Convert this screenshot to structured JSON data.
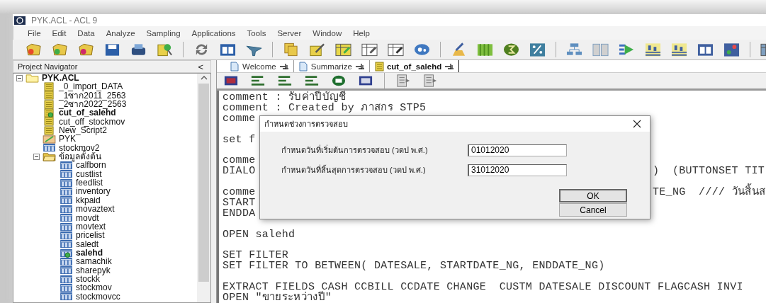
{
  "window": {
    "title": "PYK.ACL - ACL 9"
  },
  "menu": [
    "File",
    "Edit",
    "Data",
    "Analyze",
    "Sampling",
    "Applications",
    "Tools",
    "Server",
    "Window",
    "Help"
  ],
  "navigator": {
    "title": "Project Navigator",
    "collapse": "<",
    "tree": [
      {
        "label": "PYK.ACL",
        "kind": "project",
        "expanded": true,
        "active": false,
        "children": [
          {
            "label": "_0_import_DATA",
            "kind": "script",
            "active": false
          },
          {
            "label": "_1ซาก2011_2563",
            "kind": "script",
            "active": false
          },
          {
            "label": "_2ซาก2022_2563",
            "kind": "script",
            "active": false
          },
          {
            "label": "cut_of_salehd",
            "kind": "script",
            "active": true
          },
          {
            "label": "cut_off_stockmov",
            "kind": "script",
            "active": false
          },
          {
            "label": "New_Script2",
            "kind": "script",
            "active": false
          },
          {
            "label": "PYK",
            "kind": "workspace",
            "active": false
          },
          {
            "label": "stockmov2",
            "kind": "table",
            "active": false
          },
          {
            "label": "ข้อมูลตั้งต้น",
            "kind": "folder",
            "expanded": true,
            "active": false,
            "children": [
              {
                "label": "calfborn",
                "kind": "table",
                "active": false
              },
              {
                "label": "custlist",
                "kind": "table",
                "active": false
              },
              {
                "label": "feedlist",
                "kind": "table",
                "active": false
              },
              {
                "label": "inventory",
                "kind": "table",
                "active": false
              },
              {
                "label": "kkpaid",
                "kind": "table",
                "active": false
              },
              {
                "label": "movaztext",
                "kind": "table",
                "active": false
              },
              {
                "label": "movdt",
                "kind": "table",
                "active": false
              },
              {
                "label": "movtext",
                "kind": "table",
                "active": false
              },
              {
                "label": "pricelist",
                "kind": "table",
                "active": false
              },
              {
                "label": "saledt",
                "kind": "table",
                "active": false
              },
              {
                "label": "salehd",
                "kind": "table",
                "active": true
              },
              {
                "label": "samachik",
                "kind": "table",
                "active": false
              },
              {
                "label": "sharepyk",
                "kind": "table",
                "active": false
              },
              {
                "label": "stockk",
                "kind": "table",
                "active": false
              },
              {
                "label": "stockmov",
                "kind": "table",
                "active": false
              },
              {
                "label": "stockmovcc",
                "kind": "table",
                "active": false
              }
            ]
          }
        ]
      }
    ]
  },
  "tabs": [
    {
      "label": "Welcome",
      "kind": "page",
      "selected": false
    },
    {
      "label": "Summarize",
      "kind": "page",
      "selected": false
    },
    {
      "label": "cut_of_salehd",
      "kind": "script",
      "selected": true
    }
  ],
  "editor": {
    "lines": [
      {
        "kind": "code",
        "text": "comment : รับค่าปีบัญชี"
      },
      {
        "kind": "code",
        "text": "comment : Created by ภาสกร STP5"
      },
      {
        "kind": "code",
        "text": "comme"
      },
      {
        "kind": "blank"
      },
      {
        "kind": "code",
        "text": "set f"
      },
      {
        "kind": "blank"
      },
      {
        "kind": "code",
        "text": "comme"
      },
      {
        "kind": "code",
        "text": "DIALO",
        "right": ")  (BUTTONSET TIT"
      },
      {
        "kind": "blank"
      },
      {
        "kind": "code",
        "text": "comme",
        "right": "TE_NG  //// วันสิ้นส"
      },
      {
        "kind": "code",
        "text": "START"
      },
      {
        "kind": "code",
        "text": "ENDDA"
      },
      {
        "kind": "blank"
      },
      {
        "kind": "code",
        "text": "OPEN salehd"
      },
      {
        "kind": "blank"
      },
      {
        "kind": "code",
        "text": "SET FILTER"
      },
      {
        "kind": "code",
        "text": "SET FILTER TO BETWEEN( DATESALE, STARTDATE_NG, ENDDATE_NG)"
      },
      {
        "kind": "blank"
      },
      {
        "kind": "code",
        "text": "EXTRACT FIELDS CASH CCBILL CCDATE CHANGE  CUSTM DATESALE DISCOUNT FLAGCASH INVI"
      },
      {
        "kind": "code",
        "text": "OPEN \"ขายระหว่างปี\""
      }
    ]
  },
  "dialog": {
    "title": "กำหนดช่วงการตรวจสอบ",
    "fields": [
      {
        "label": "กำหนดวันที่เริ่มต้นการตรวจสอบ (วดป พ.ศ.)",
        "value": "01012020"
      },
      {
        "label": "กำหนดวันที่สิ้นสุดการตรวจสอบ (วดป พ.ศ.)",
        "value": "31012020"
      }
    ],
    "buttons": [
      {
        "label": "OK",
        "default": true
      },
      {
        "label": "Cancel",
        "default": false
      }
    ]
  }
}
